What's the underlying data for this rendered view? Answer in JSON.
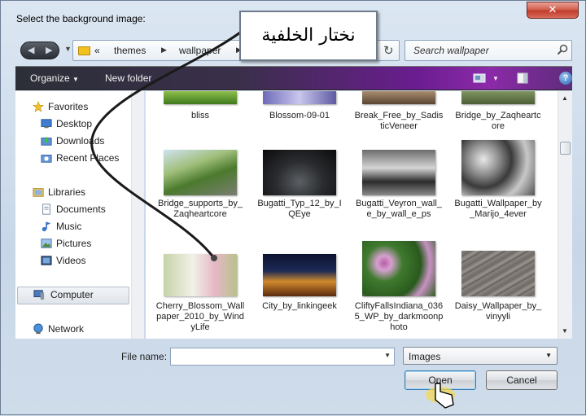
{
  "window": {
    "title": "Select the background image:",
    "close_label": "✕"
  },
  "address": {
    "overflow": "«",
    "crumbs": [
      "themes",
      "wallpaper"
    ],
    "search_placeholder": "Search wallpaper"
  },
  "toolbar": {
    "organize": "Organize",
    "new_folder": "New folder"
  },
  "nav": {
    "favorites": "Favorites",
    "desktop": "Desktop",
    "downloads": "Downloads",
    "recent": "Recent Places",
    "libraries": "Libraries",
    "documents": "Documents",
    "music": "Music",
    "pictures": "Pictures",
    "videos": "Videos",
    "computer": "Computer",
    "network": "Network"
  },
  "files": [
    {
      "label": "bliss"
    },
    {
      "label": "Blossom-09-01"
    },
    {
      "label": "Break_Free_by_SadisticVeneer"
    },
    {
      "label": "Bridge_by_Zaqheartcore"
    },
    {
      "label": "Bridge_supports_by_Zaqheartcore"
    },
    {
      "label": "Bugatti_Typ_12_by_IQEye"
    },
    {
      "label": "Bugatti_Veyron_wall_e_by_wall_e_ps"
    },
    {
      "label": "Bugatti_Wallpaper_by_Marijo_4ever"
    },
    {
      "label": "Cherry_Blossom_Wallpaper_2010_by_WindyLife"
    },
    {
      "label": "City_by_linkingeek"
    },
    {
      "label": "CliftyFallsIndiana_0365_WP_by_darkmoonphoto"
    },
    {
      "label": "Daisy_Wallpaper_by_vinyyli"
    }
  ],
  "bottom": {
    "file_name_label": "File name:",
    "file_name_value": "",
    "file_type": "Images",
    "open": "Open",
    "cancel": "Cancel"
  },
  "annotation": {
    "text": "نختار الخلفية"
  },
  "colors": {
    "toolbar_accent": "#8c2aa9",
    "close": "#c0392b",
    "selection": "#dbe9f9"
  }
}
